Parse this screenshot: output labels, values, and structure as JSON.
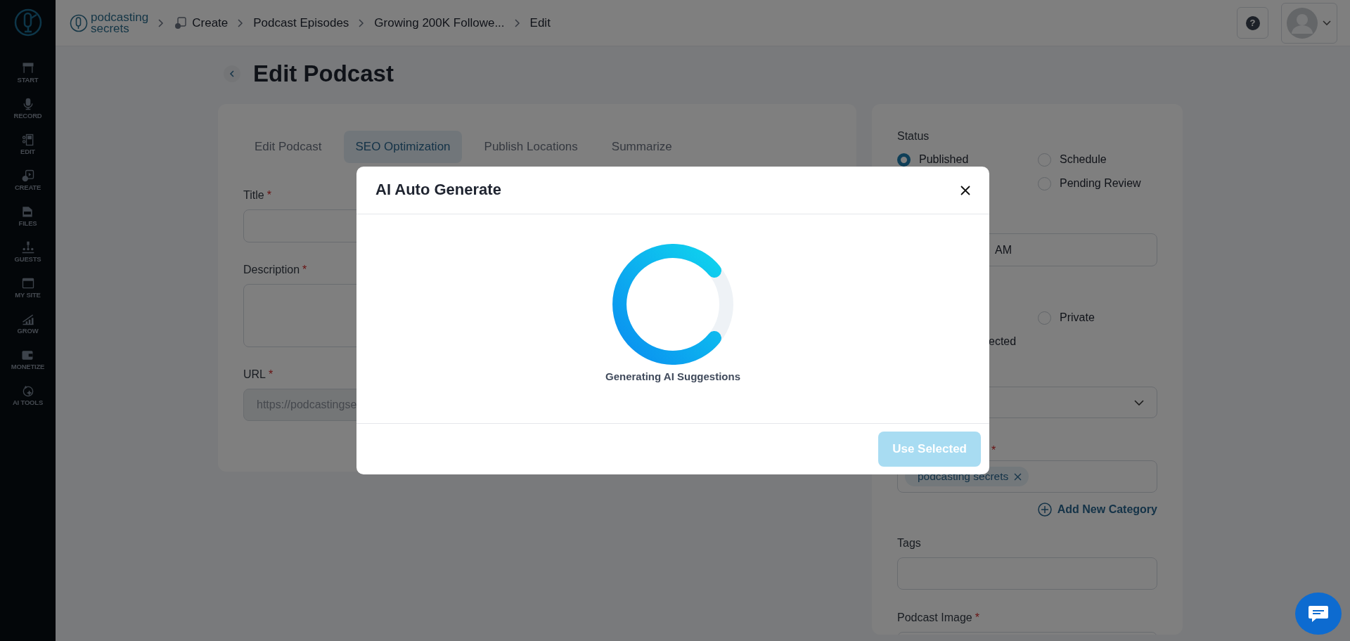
{
  "sidebar": {
    "items": [
      {
        "label": "START"
      },
      {
        "label": "RECORD"
      },
      {
        "label": "EDIT"
      },
      {
        "label": "CREATE"
      },
      {
        "label": "FILES"
      },
      {
        "label": "GUESTS"
      },
      {
        "label": "MY SITE"
      },
      {
        "label": "GROW"
      },
      {
        "label": "MONETIZE"
      },
      {
        "label": "AI TOOLS"
      }
    ]
  },
  "header": {
    "logo_line_1": "podcasting",
    "logo_line_2": "secrets",
    "breadcrumbs": [
      {
        "label": "Create",
        "icon": true
      },
      {
        "label": "Podcast Episodes",
        "icon": false
      },
      {
        "label": "Growing 200K Followe...",
        "icon": false
      },
      {
        "label": "Edit",
        "icon": false
      }
    ],
    "help": "?"
  },
  "page": {
    "title": "Edit Podcast"
  },
  "editor": {
    "tabs": [
      {
        "label": "Edit Podcast",
        "selected": false
      },
      {
        "label": "SEO Optimization",
        "selected": true
      },
      {
        "label": "Publish Locations",
        "selected": false
      },
      {
        "label": "Summarize",
        "selected": false
      }
    ],
    "fields": [
      {
        "label": "Title",
        "required_mark": "*",
        "kind": "input"
      },
      {
        "label": "Description",
        "required_mark": "*",
        "kind": "textarea"
      },
      {
        "label": "URL",
        "required_mark": "*",
        "kind": "readonly",
        "placeholder": "https://podcastingse"
      }
    ]
  },
  "sidebar_panel": {
    "status_label": "Status",
    "status_options": [
      {
        "label": "Published",
        "selected": true
      },
      {
        "label": "Schedule",
        "selected": false
      },
      {
        "label": "Pending Review",
        "selected": false
      }
    ],
    "date_value": "AM",
    "visibility_options": [
      {
        "label": "Private",
        "selected": false
      }
    ],
    "visibility_fragment": "ected",
    "categories_required_mark": "*",
    "categories": [
      {
        "label": "podcasting secrets"
      }
    ],
    "add_category": "Add New Category",
    "tags_label": "Tags",
    "image_label": "Podcast Image",
    "image_required_mark": "*"
  },
  "modal": {
    "title": "AI Auto Generate",
    "message": "Generating AI Suggestions",
    "button": {
      "label": "Use Selected",
      "disabled": true
    }
  }
}
